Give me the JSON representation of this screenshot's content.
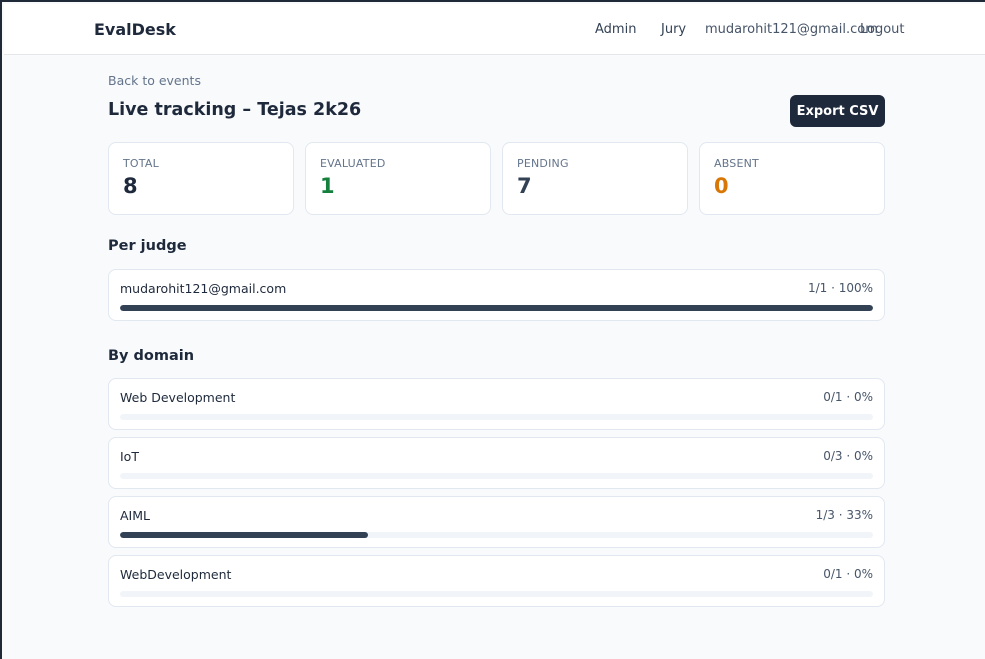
{
  "header": {
    "brand": "EvalDesk",
    "nav_admin": "Admin",
    "nav_jury": "Jury",
    "user_email": "mudarohit121@gmail.com",
    "logout": "Logout"
  },
  "page": {
    "back_link": "Back to events",
    "title": "Live tracking – Tejas 2k26",
    "export_button": "Export CSV"
  },
  "stats": [
    {
      "label": "TOTAL",
      "value": "8",
      "color": "#1e293b"
    },
    {
      "label": "EVALUATED",
      "value": "1",
      "color": "#15803d"
    },
    {
      "label": "PENDING",
      "value": "7",
      "color": "#334155"
    },
    {
      "label": "ABSENT",
      "value": "0",
      "color": "#d97706"
    }
  ],
  "per_judge": {
    "title": "Per judge",
    "rows": [
      {
        "label": "mudarohit121@gmail.com",
        "stat": "1/1 · 100%",
        "progress": 1.0
      }
    ]
  },
  "by_domain": {
    "title": "By domain",
    "rows": [
      {
        "label": "Web Development",
        "stat": "0/1 · 0%",
        "progress": 0.0
      },
      {
        "label": "IoT",
        "stat": "0/3 · 0%",
        "progress": 0.0
      },
      {
        "label": "AIML",
        "stat": "1/3 · 33%",
        "progress": 0.33
      },
      {
        "label": "WebDevelopment",
        "stat": "0/1 · 0%",
        "progress": 0.0
      }
    ]
  }
}
